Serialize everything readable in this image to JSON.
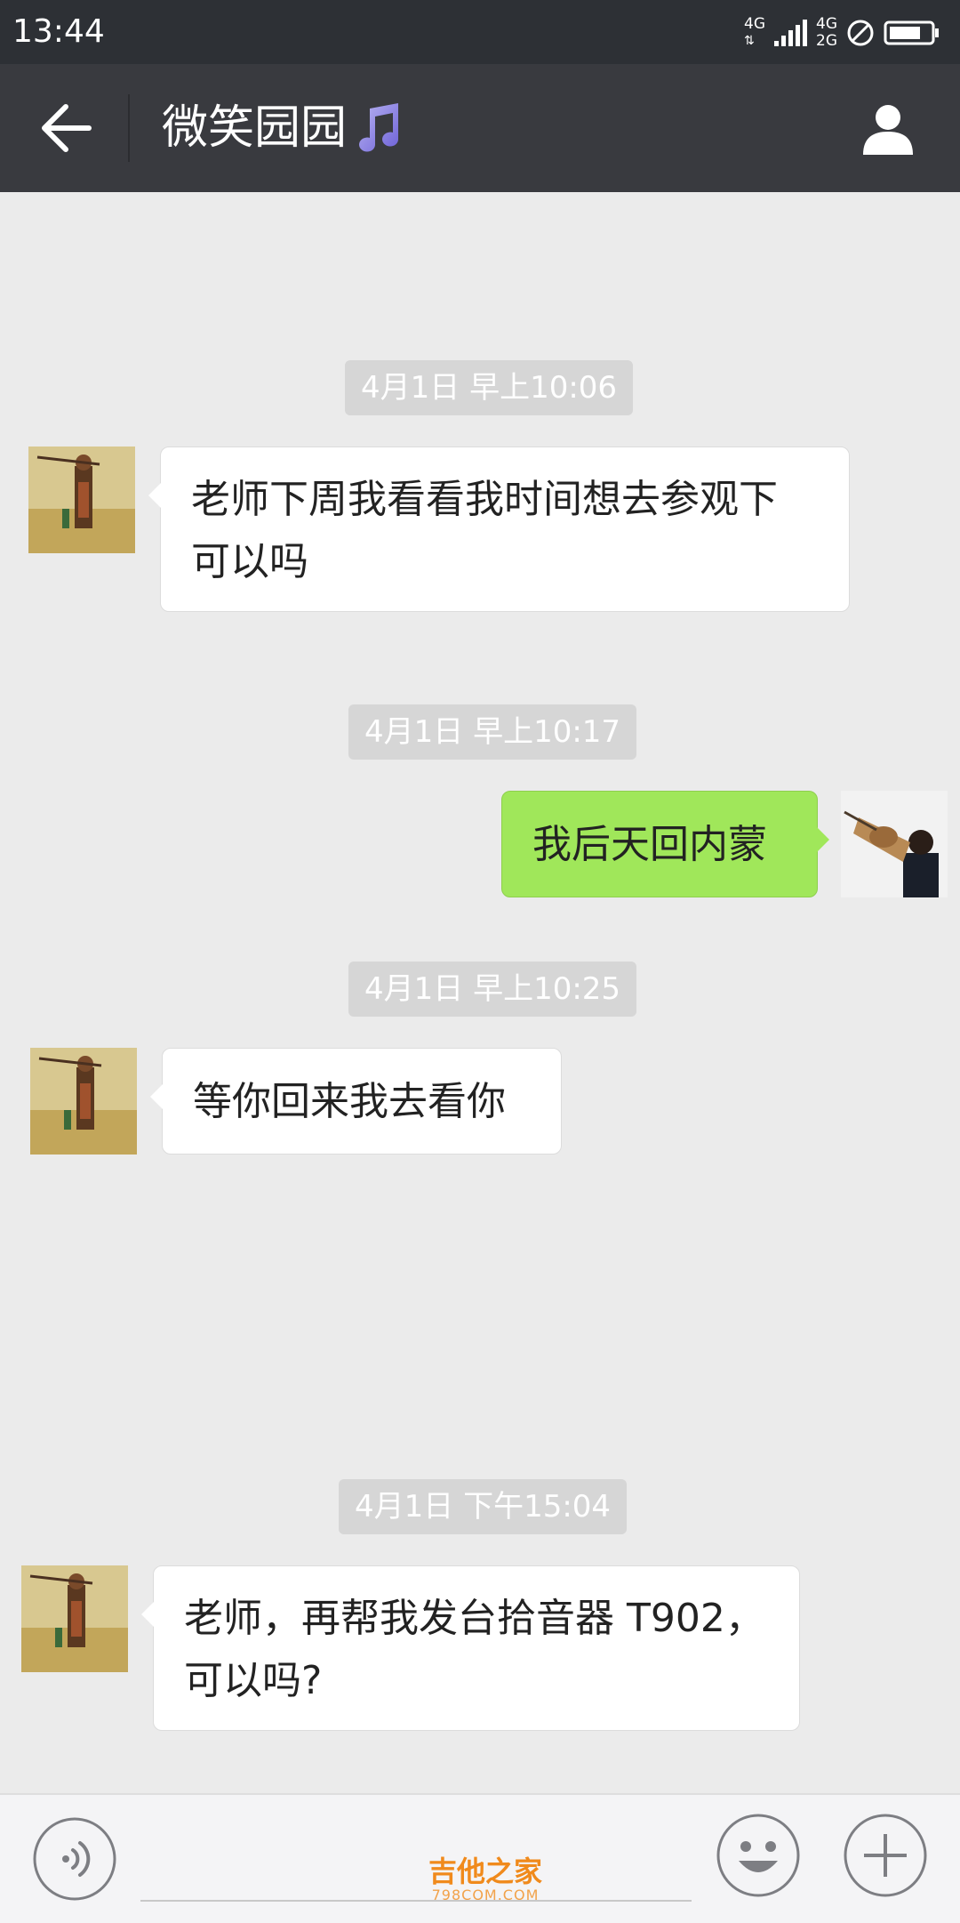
{
  "status_bar": {
    "time": "13:44",
    "net1": "4G",
    "net2_top": "4G",
    "net2_bottom": "2G"
  },
  "header": {
    "title": "微笑园园",
    "back_icon": "arrow-left-icon",
    "profile_icon": "person-icon",
    "title_icon": "music-note-icon"
  },
  "messages": [
    {
      "timestamp": "4月1日 早上10:06",
      "side": "left",
      "lines": [
        "老师下周我看看我时间想去参观下",
        "可以吗"
      ]
    },
    {
      "timestamp": "4月1日 早上10:17",
      "side": "right",
      "lines": [
        "我后天回内蒙"
      ]
    },
    {
      "timestamp": "4月1日 早上10:25",
      "side": "left",
      "lines": [
        "等你回来我去看你"
      ]
    },
    {
      "timestamp": "4月1日 下午15:04",
      "side": "left",
      "lines": [
        "老师，再帮我发台拾音器 T902，",
        "可以吗?"
      ]
    }
  ],
  "input_bar": {
    "voice_icon": "voice-icon",
    "emoji_icon": "smiley-icon",
    "more_icon": "plus-icon"
  },
  "watermark": {
    "main": "吉他之家",
    "sub": "798COM.COM"
  },
  "colors": {
    "header_bg": "#393a3f",
    "chat_bg": "#ebebeb",
    "own_bubble": "#a0e75a"
  }
}
